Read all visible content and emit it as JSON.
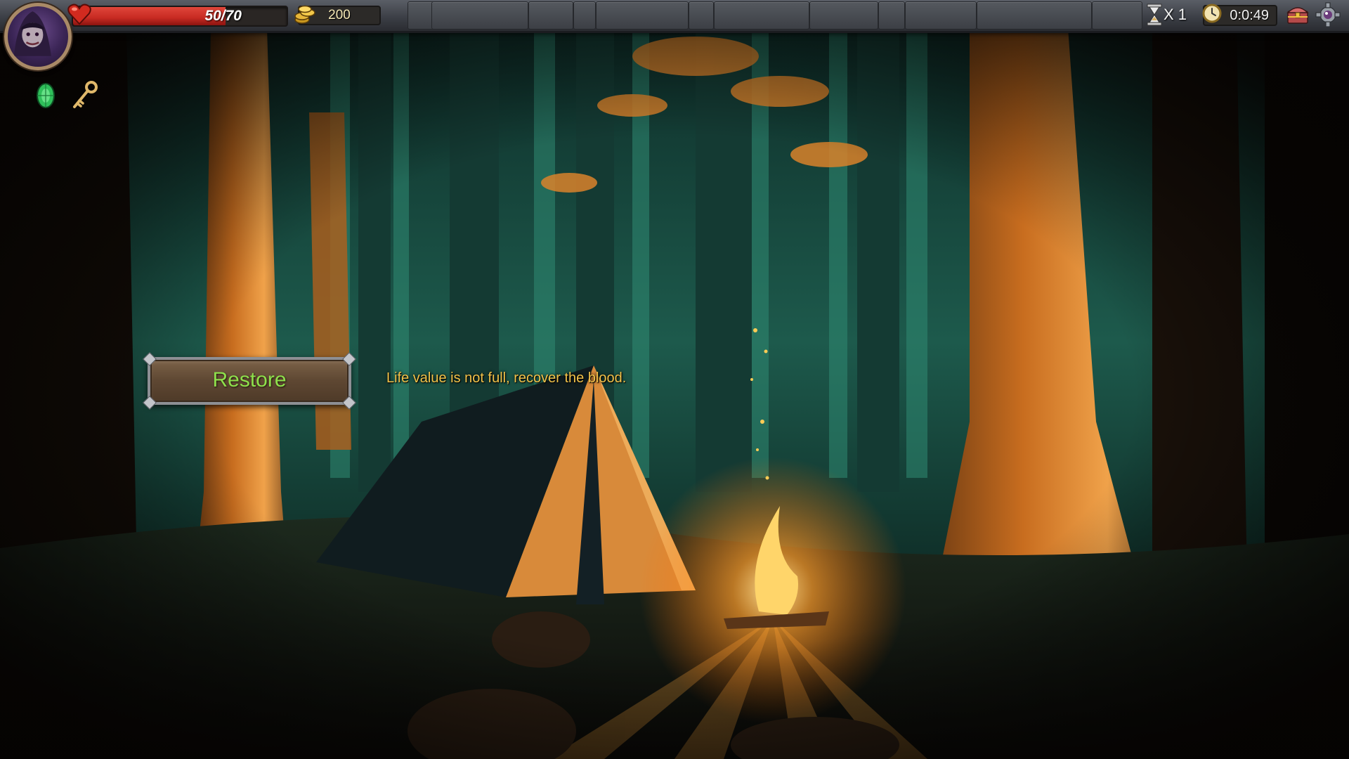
{
  "hud": {
    "hp_text": "50/70",
    "hp_current": 50,
    "hp_max": 70,
    "gold": "200",
    "speed_text": "X 1",
    "timer": "0:0:49"
  },
  "icons": {
    "portrait": "hooded-avatar-icon",
    "heart": "heart-icon",
    "coins": "gold-coins-icon",
    "gem": "green-gem-icon",
    "key": "key-icon",
    "speed": "hourglass-icon",
    "clock": "clock-icon",
    "chest": "treasure-chest-icon",
    "settings": "gear-icon"
  },
  "action": {
    "restore_label": "Restore",
    "message": "Life value is not full, recover the blood."
  },
  "colors": {
    "hp_fill": "#c72a22",
    "restore_text": "#8ee04c",
    "message_text": "#f2c24a"
  }
}
